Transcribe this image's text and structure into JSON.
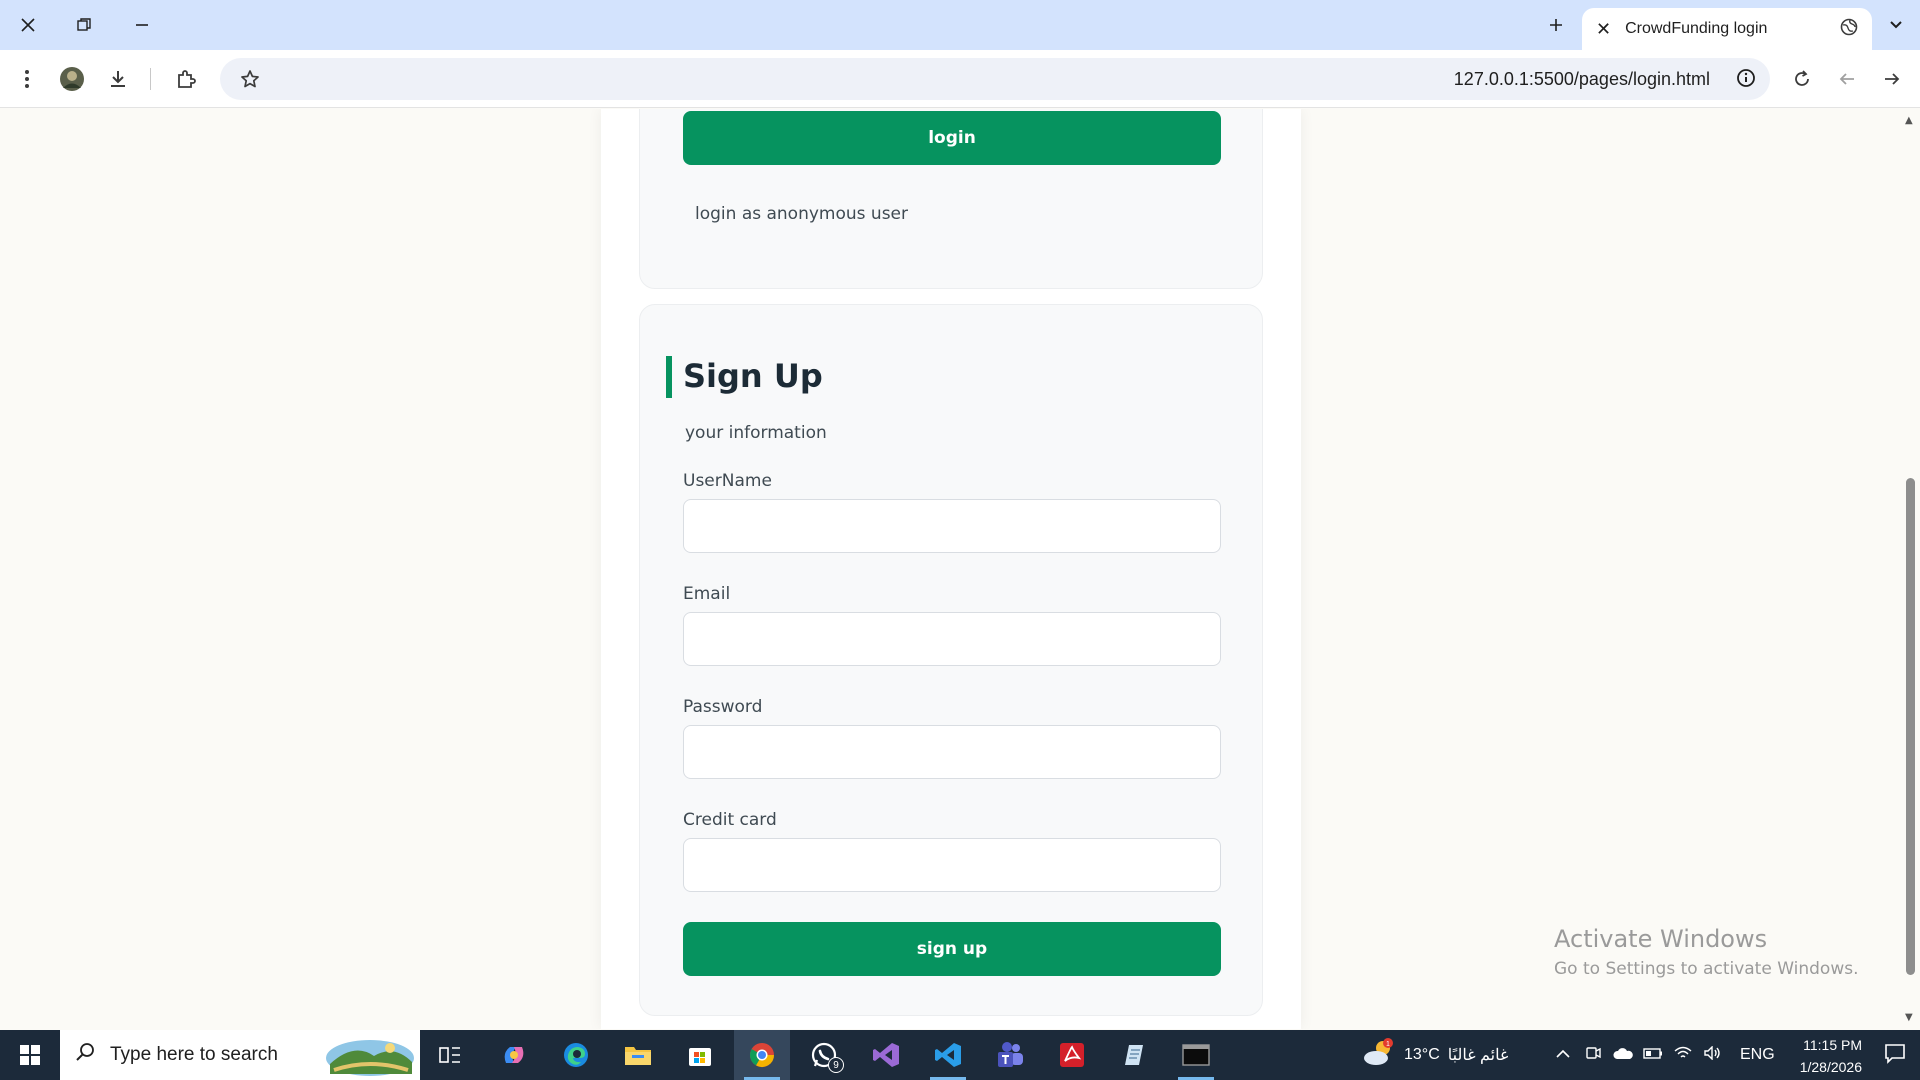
{
  "browser": {
    "tab_title": "CrowdFunding login",
    "url": "127.0.0.1:5500/pages/login.html"
  },
  "login_card": {
    "login_button": "login",
    "anonymous_link": "login as anonymous user"
  },
  "signup": {
    "title": "Sign Up",
    "subtitle": "your information",
    "fields": [
      {
        "label": "UserName",
        "value": ""
      },
      {
        "label": "Email",
        "value": ""
      },
      {
        "label": "Password",
        "value": ""
      },
      {
        "label": "Credit card",
        "value": ""
      }
    ],
    "submit_button": "sign up"
  },
  "watermark": {
    "line1": "Activate Windows",
    "line2": "Go to Settings to activate Windows."
  },
  "taskbar": {
    "search_placeholder": "Type here to search",
    "whatsapp_badge": "9",
    "weather_temp": "13°C",
    "weather_text": "غائم غالبًا",
    "language": "ENG",
    "time": "11:15 PM",
    "date": "1/28/2026"
  },
  "colors": {
    "accent_green": "#06935f",
    "tabbar_blue": "#d3e3fd",
    "taskbar_dark": "#1c2a3a"
  }
}
